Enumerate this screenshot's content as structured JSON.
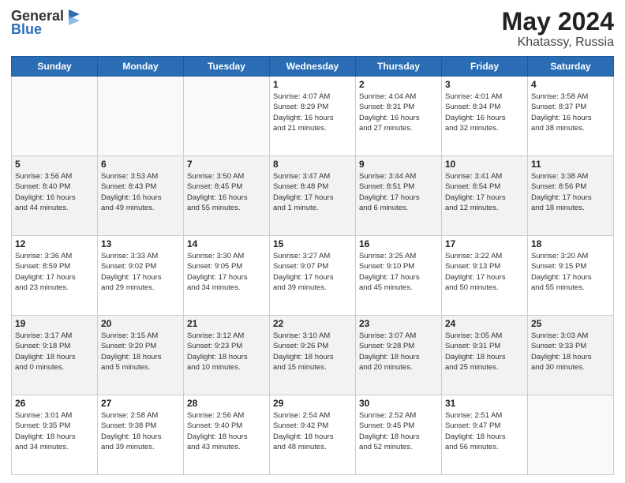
{
  "header": {
    "logo_general": "General",
    "logo_blue": "Blue",
    "month_year": "May 2024",
    "location": "Khatassy, Russia"
  },
  "weekdays": [
    "Sunday",
    "Monday",
    "Tuesday",
    "Wednesday",
    "Thursday",
    "Friday",
    "Saturday"
  ],
  "weeks": [
    [
      {
        "day": "",
        "info": ""
      },
      {
        "day": "",
        "info": ""
      },
      {
        "day": "",
        "info": ""
      },
      {
        "day": "1",
        "info": "Sunrise: 4:07 AM\nSunset: 8:29 PM\nDaylight: 16 hours\nand 21 minutes."
      },
      {
        "day": "2",
        "info": "Sunrise: 4:04 AM\nSunset: 8:31 PM\nDaylight: 16 hours\nand 27 minutes."
      },
      {
        "day": "3",
        "info": "Sunrise: 4:01 AM\nSunset: 8:34 PM\nDaylight: 16 hours\nand 32 minutes."
      },
      {
        "day": "4",
        "info": "Sunrise: 3:58 AM\nSunset: 8:37 PM\nDaylight: 16 hours\nand 38 minutes."
      }
    ],
    [
      {
        "day": "5",
        "info": "Sunrise: 3:56 AM\nSunset: 8:40 PM\nDaylight: 16 hours\nand 44 minutes."
      },
      {
        "day": "6",
        "info": "Sunrise: 3:53 AM\nSunset: 8:43 PM\nDaylight: 16 hours\nand 49 minutes."
      },
      {
        "day": "7",
        "info": "Sunrise: 3:50 AM\nSunset: 8:45 PM\nDaylight: 16 hours\nand 55 minutes."
      },
      {
        "day": "8",
        "info": "Sunrise: 3:47 AM\nSunset: 8:48 PM\nDaylight: 17 hours\nand 1 minute."
      },
      {
        "day": "9",
        "info": "Sunrise: 3:44 AM\nSunset: 8:51 PM\nDaylight: 17 hours\nand 6 minutes."
      },
      {
        "day": "10",
        "info": "Sunrise: 3:41 AM\nSunset: 8:54 PM\nDaylight: 17 hours\nand 12 minutes."
      },
      {
        "day": "11",
        "info": "Sunrise: 3:38 AM\nSunset: 8:56 PM\nDaylight: 17 hours\nand 18 minutes."
      }
    ],
    [
      {
        "day": "12",
        "info": "Sunrise: 3:36 AM\nSunset: 8:59 PM\nDaylight: 17 hours\nand 23 minutes."
      },
      {
        "day": "13",
        "info": "Sunrise: 3:33 AM\nSunset: 9:02 PM\nDaylight: 17 hours\nand 29 minutes."
      },
      {
        "day": "14",
        "info": "Sunrise: 3:30 AM\nSunset: 9:05 PM\nDaylight: 17 hours\nand 34 minutes."
      },
      {
        "day": "15",
        "info": "Sunrise: 3:27 AM\nSunset: 9:07 PM\nDaylight: 17 hours\nand 39 minutes."
      },
      {
        "day": "16",
        "info": "Sunrise: 3:25 AM\nSunset: 9:10 PM\nDaylight: 17 hours\nand 45 minutes."
      },
      {
        "day": "17",
        "info": "Sunrise: 3:22 AM\nSunset: 9:13 PM\nDaylight: 17 hours\nand 50 minutes."
      },
      {
        "day": "18",
        "info": "Sunrise: 3:20 AM\nSunset: 9:15 PM\nDaylight: 17 hours\nand 55 minutes."
      }
    ],
    [
      {
        "day": "19",
        "info": "Sunrise: 3:17 AM\nSunset: 9:18 PM\nDaylight: 18 hours\nand 0 minutes."
      },
      {
        "day": "20",
        "info": "Sunrise: 3:15 AM\nSunset: 9:20 PM\nDaylight: 18 hours\nand 5 minutes."
      },
      {
        "day": "21",
        "info": "Sunrise: 3:12 AM\nSunset: 9:23 PM\nDaylight: 18 hours\nand 10 minutes."
      },
      {
        "day": "22",
        "info": "Sunrise: 3:10 AM\nSunset: 9:26 PM\nDaylight: 18 hours\nand 15 minutes."
      },
      {
        "day": "23",
        "info": "Sunrise: 3:07 AM\nSunset: 9:28 PM\nDaylight: 18 hours\nand 20 minutes."
      },
      {
        "day": "24",
        "info": "Sunrise: 3:05 AM\nSunset: 9:31 PM\nDaylight: 18 hours\nand 25 minutes."
      },
      {
        "day": "25",
        "info": "Sunrise: 3:03 AM\nSunset: 9:33 PM\nDaylight: 18 hours\nand 30 minutes."
      }
    ],
    [
      {
        "day": "26",
        "info": "Sunrise: 3:01 AM\nSunset: 9:35 PM\nDaylight: 18 hours\nand 34 minutes."
      },
      {
        "day": "27",
        "info": "Sunrise: 2:58 AM\nSunset: 9:38 PM\nDaylight: 18 hours\nand 39 minutes."
      },
      {
        "day": "28",
        "info": "Sunrise: 2:56 AM\nSunset: 9:40 PM\nDaylight: 18 hours\nand 43 minutes."
      },
      {
        "day": "29",
        "info": "Sunrise: 2:54 AM\nSunset: 9:42 PM\nDaylight: 18 hours\nand 48 minutes."
      },
      {
        "day": "30",
        "info": "Sunrise: 2:52 AM\nSunset: 9:45 PM\nDaylight: 18 hours\nand 52 minutes."
      },
      {
        "day": "31",
        "info": "Sunrise: 2:51 AM\nSunset: 9:47 PM\nDaylight: 18 hours\nand 56 minutes."
      },
      {
        "day": "",
        "info": ""
      }
    ]
  ]
}
